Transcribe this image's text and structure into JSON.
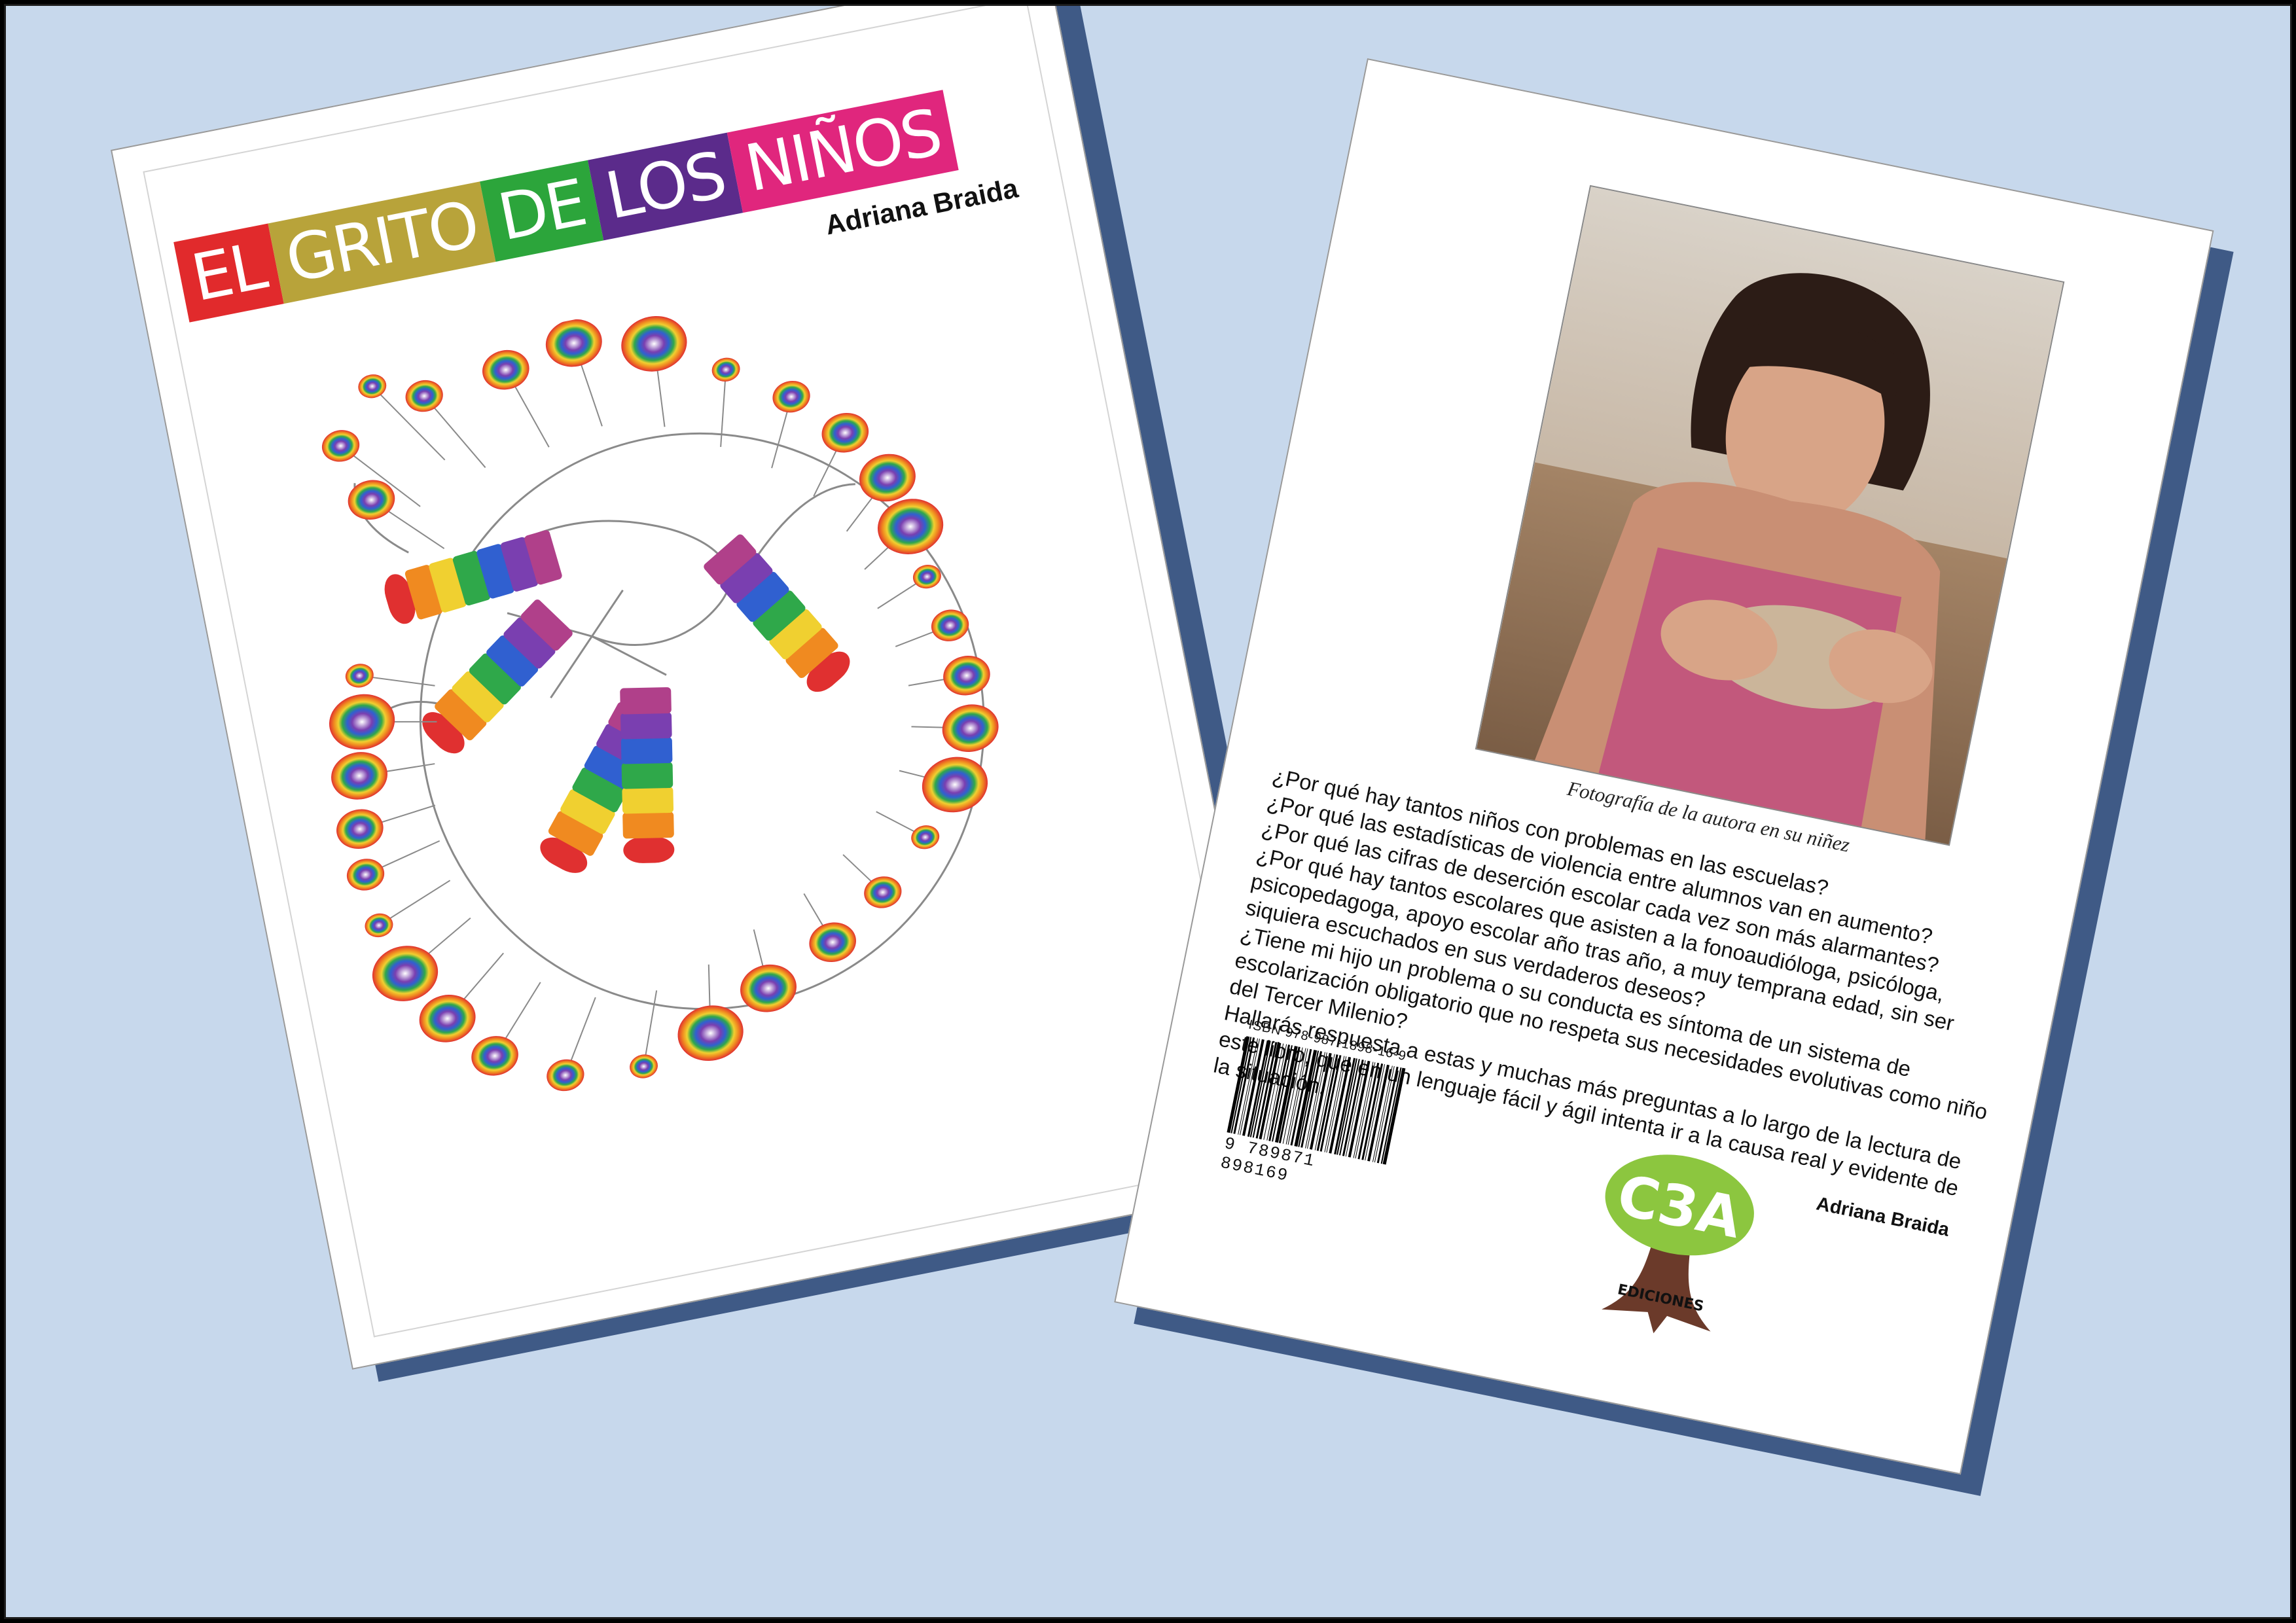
{
  "front": {
    "title_words": [
      "EL",
      "GRITO",
      "DE",
      "LOS",
      "NIÑOS"
    ],
    "author": "Adriana Braida"
  },
  "back": {
    "caption": "Fotografía de la autora en su niñez",
    "paragraphs": [
      "¿Por qué hay tantos niños con problemas en las escuelas?",
      "¿Por qué las estadísticas de violencia entre alumnos van en aumento?",
      "¿Por qué las cifras  de deserción escolar cada vez son más alarmantes?",
      "¿Por qué hay tantos escolares que asisten a la fonoaudióloga, psicóloga, psicopedagoga, apoyo escolar año tras año, a muy temprana edad, sin ser siquiera escuchados  en sus verdaderos deseos?",
      "¿Tiene mi hijo un problema o su conducta  es síntoma de un sistema de escolarización obligatorio que no respeta sus necesidades evolutivas como niño del Tercer Milenio?",
      "Hallarás respuesta a estas y muchas más preguntas a lo largo de la lectura de este libro, que en un lenguaje fácil y ágil intenta ir a la causa real y evidente de la situación."
    ],
    "author": "Adriana Braida",
    "isbn": "ISBN 978-987-1898-16-9",
    "barcode_digits": "9 789871 898169",
    "publisher_logo_text": "C3A",
    "publisher_sub": "EDICIONES"
  },
  "colors": {
    "background": "#c7d8ec",
    "title_red": "#e12a2c",
    "title_gold": "#b8a33a",
    "title_green": "#2ca53b",
    "title_purple": "#5b2b8b",
    "title_pink": "#e0267d",
    "logo_green": "#8cc63f",
    "logo_brown": "#6b3a2a"
  }
}
